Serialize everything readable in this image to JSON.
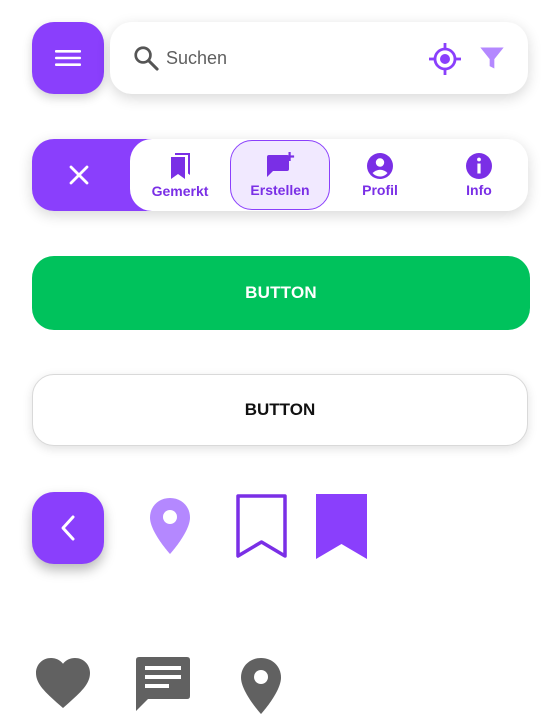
{
  "search": {
    "placeholder": "Suchen",
    "icon": "search-icon",
    "locate_icon": "my-location-icon",
    "filter_icon": "filter-icon"
  },
  "menu": {
    "icon": "menu-icon"
  },
  "nav": {
    "close_icon": "close-icon",
    "items": [
      {
        "label": "Gemerkt",
        "icon": "bookmarks-icon",
        "active": false
      },
      {
        "label": "Erstellen",
        "icon": "add-comment-icon",
        "active": true
      },
      {
        "label": "Profil",
        "icon": "account-circle-icon",
        "active": false
      },
      {
        "label": "Info",
        "icon": "info-icon",
        "active": false
      }
    ]
  },
  "buttons": {
    "primary_label": "BUTTON",
    "outline_label": "BUTTON"
  },
  "icons_row": [
    "chevron-left-icon",
    "location-pin-icon",
    "bookmark-outline-icon",
    "bookmark-filled-icon"
  ],
  "gray_icons": [
    "heart-icon",
    "comment-icon",
    "location-pin-icon"
  ],
  "colors": {
    "accent": "#8a3ffc",
    "accent_text": "#7a2fe6",
    "accent_light": "#b488ff",
    "active_bg": "#f1e9ff",
    "success": "#00c25c",
    "gray_icon": "#616161"
  }
}
